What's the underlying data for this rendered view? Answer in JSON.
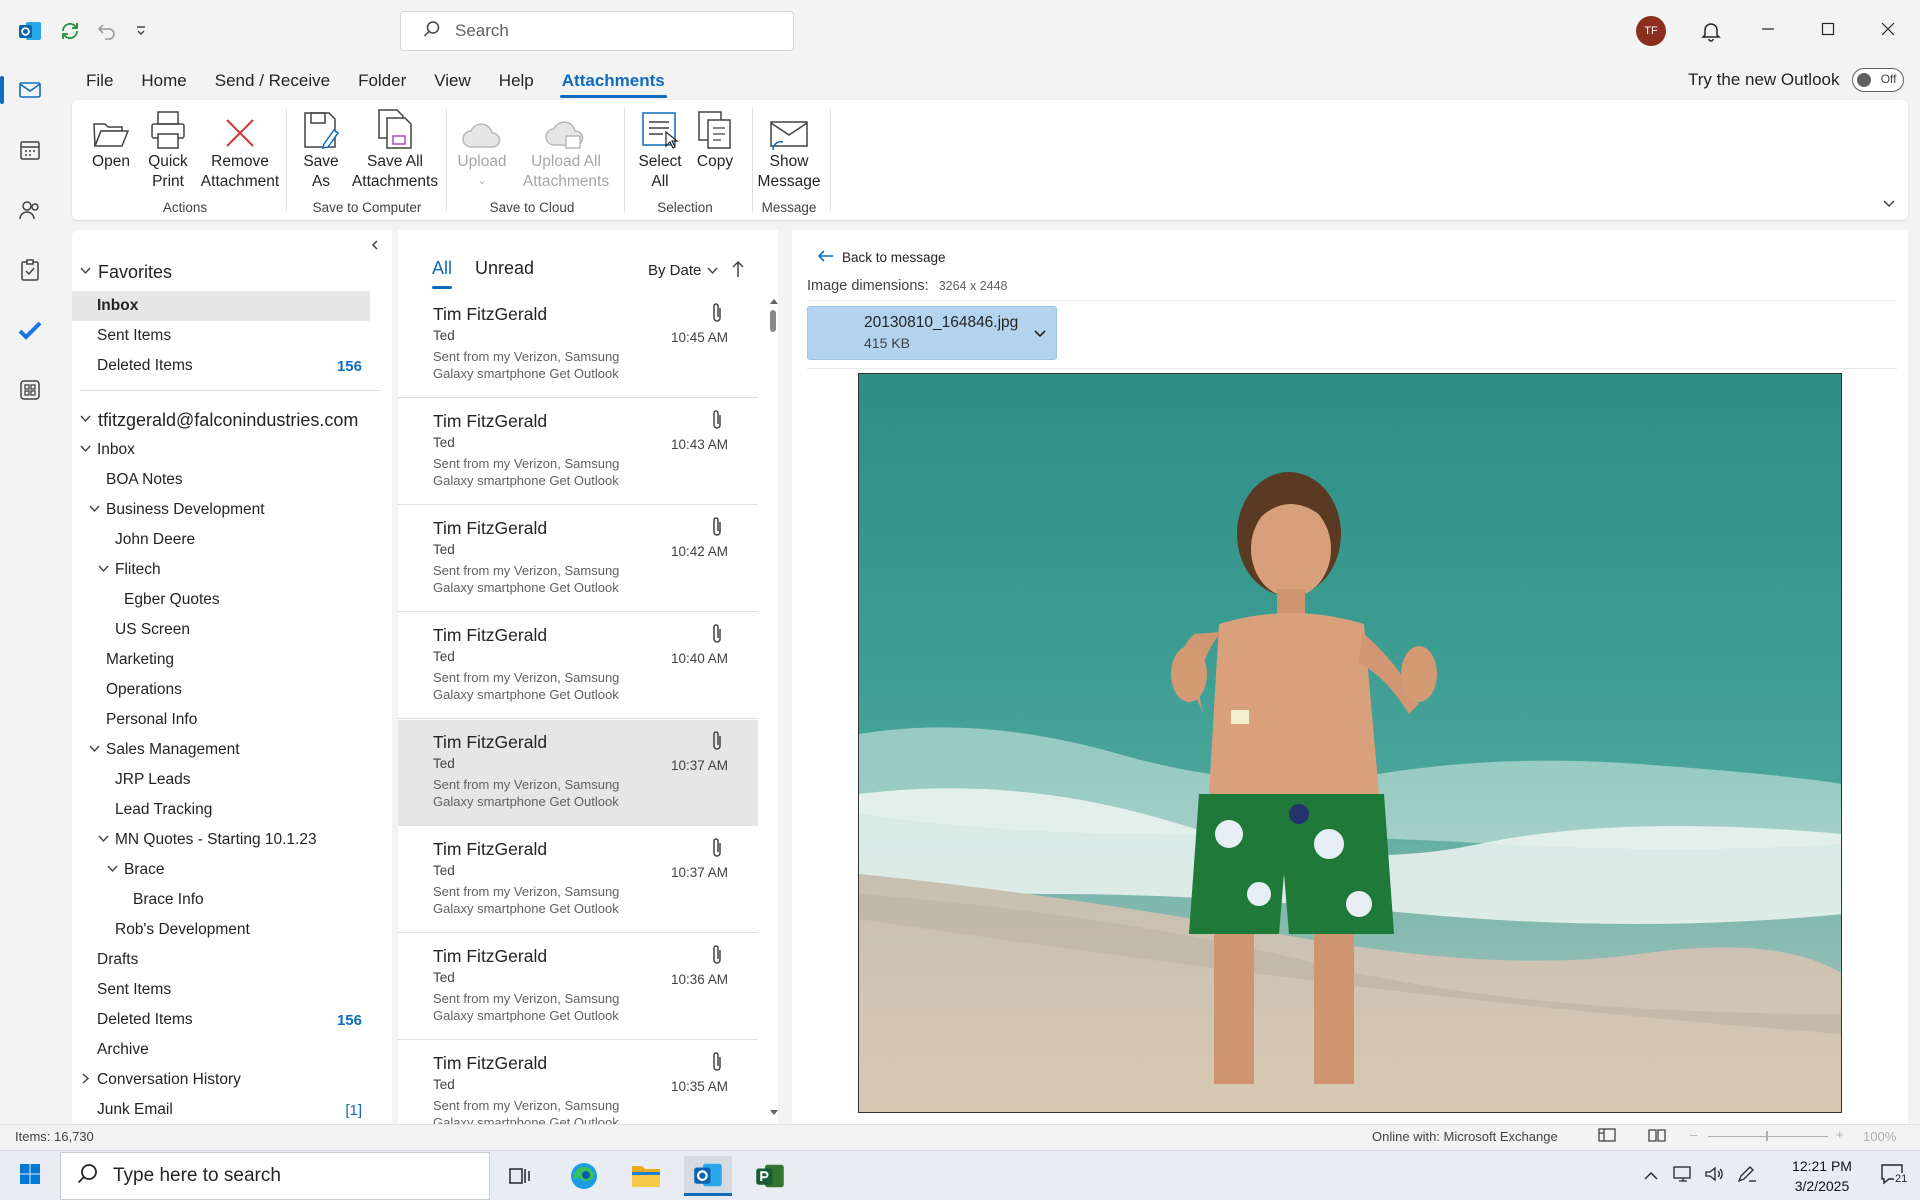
{
  "titlebar": {
    "search_placeholder": "Search",
    "avatar_initials": "TF"
  },
  "menu": {
    "tabs": [
      "File",
      "Home",
      "Send / Receive",
      "Folder",
      "View",
      "Help",
      "Attachments"
    ],
    "active_tab": "Attachments",
    "try_new_label": "Try the new Outlook",
    "toggle_label": "Off"
  },
  "ribbon": {
    "open": "Open",
    "quick_print_1": "Quick",
    "quick_print_2": "Print",
    "remove_1": "Remove",
    "remove_2": "Attachment",
    "save_as_1": "Save",
    "save_as_2": "As",
    "save_all_1": "Save All",
    "save_all_2": "Attachments",
    "upload": "Upload",
    "upload_all_1": "Upload All",
    "upload_all_2": "Attachments",
    "select_all_1": "Select",
    "select_all_2": "All",
    "copy": "Copy",
    "show_message_1": "Show",
    "show_message_2": "Message",
    "groups": {
      "actions": "Actions",
      "save_computer": "Save to Computer",
      "save_cloud": "Save to Cloud",
      "selection": "Selection",
      "message": "Message"
    }
  },
  "folders": {
    "favorites_label": "Favorites",
    "favorites": [
      {
        "label": "Inbox",
        "count": ""
      },
      {
        "label": "Sent Items",
        "count": ""
      },
      {
        "label": "Deleted Items",
        "count": "156"
      }
    ],
    "account": "tfitzgerald@falconindustries.com",
    "tree": [
      {
        "label": "Inbox",
        "count": ""
      },
      {
        "label": "BOA Notes",
        "count": ""
      },
      {
        "label": "Business Development",
        "count": ""
      },
      {
        "label": "John Deere",
        "count": ""
      },
      {
        "label": "Flitech",
        "count": ""
      },
      {
        "label": "Egber Quotes",
        "count": ""
      },
      {
        "label": "US Screen",
        "count": ""
      },
      {
        "label": "Marketing",
        "count": ""
      },
      {
        "label": "Operations",
        "count": ""
      },
      {
        "label": "Personal Info",
        "count": ""
      },
      {
        "label": "Sales Management",
        "count": ""
      },
      {
        "label": "JRP Leads",
        "count": ""
      },
      {
        "label": "Lead Tracking",
        "count": ""
      },
      {
        "label": "MN Quotes - Starting 10.1.23",
        "count": ""
      },
      {
        "label": "Brace",
        "count": ""
      },
      {
        "label": "Brace Info",
        "count": ""
      },
      {
        "label": "Rob's Development",
        "count": ""
      },
      {
        "label": "Drafts",
        "count": ""
      },
      {
        "label": "Sent Items",
        "count": ""
      },
      {
        "label": "Deleted Items",
        "count": "156"
      },
      {
        "label": "Archive",
        "count": ""
      },
      {
        "label": "Conversation History",
        "count": ""
      },
      {
        "label": "Junk Email",
        "count": "[1]"
      }
    ]
  },
  "messagelist": {
    "filter_all": "All",
    "filter_unread": "Unread",
    "sort": "By Date",
    "messages": [
      {
        "from": "Tim FitzGerald",
        "subject": "Ted",
        "preview": "Sent from my Verizon, Samsung Galaxy smartphone Get Outlook",
        "time": "10:45 AM"
      },
      {
        "from": "Tim FitzGerald",
        "subject": "Ted",
        "preview": "Sent from my Verizon, Samsung Galaxy smartphone Get Outlook",
        "time": "10:43 AM"
      },
      {
        "from": "Tim FitzGerald",
        "subject": "Ted",
        "preview": "Sent from my Verizon, Samsung Galaxy smartphone Get Outlook",
        "time": "10:42 AM"
      },
      {
        "from": "Tim FitzGerald",
        "subject": "Ted",
        "preview": "Sent from my Verizon, Samsung Galaxy smartphone Get Outlook",
        "time": "10:40 AM"
      },
      {
        "from": "Tim FitzGerald",
        "subject": "Ted",
        "preview": "Sent from my Verizon, Samsung Galaxy smartphone Get Outlook",
        "time": "10:37 AM"
      },
      {
        "from": "Tim FitzGerald",
        "subject": "Ted",
        "preview": "Sent from my Verizon, Samsung Galaxy smartphone Get Outlook",
        "time": "10:37 AM"
      },
      {
        "from": "Tim FitzGerald",
        "subject": "Ted",
        "preview": "Sent from my Verizon, Samsung Galaxy smartphone Get Outlook",
        "time": "10:36 AM"
      },
      {
        "from": "Tim FitzGerald",
        "subject": "Ted",
        "preview": "Sent from my Verizon, Samsung Galaxy smartphone Get Outlook",
        "time": "10:35 AM"
      }
    ],
    "selected_index": 4
  },
  "reading": {
    "back_label": "Back to message",
    "dims_label": "Image dimensions:",
    "dims_value": "3264 x 2448",
    "attachment_name": "20130810_164846.jpg",
    "attachment_size": "415 KB"
  },
  "status": {
    "items": "Items: 16,730",
    "connection": "Online with: Microsoft Exchange",
    "zoom": "100%"
  },
  "taskbar": {
    "search_placeholder": "Type here to search",
    "time": "12:21 PM",
    "date": "3/2/2025",
    "notifications": "21"
  },
  "colors": {
    "accent": "#0f6cbd",
    "avatar": "#8b2e1e",
    "attachment_card": "#b4d3ee"
  }
}
